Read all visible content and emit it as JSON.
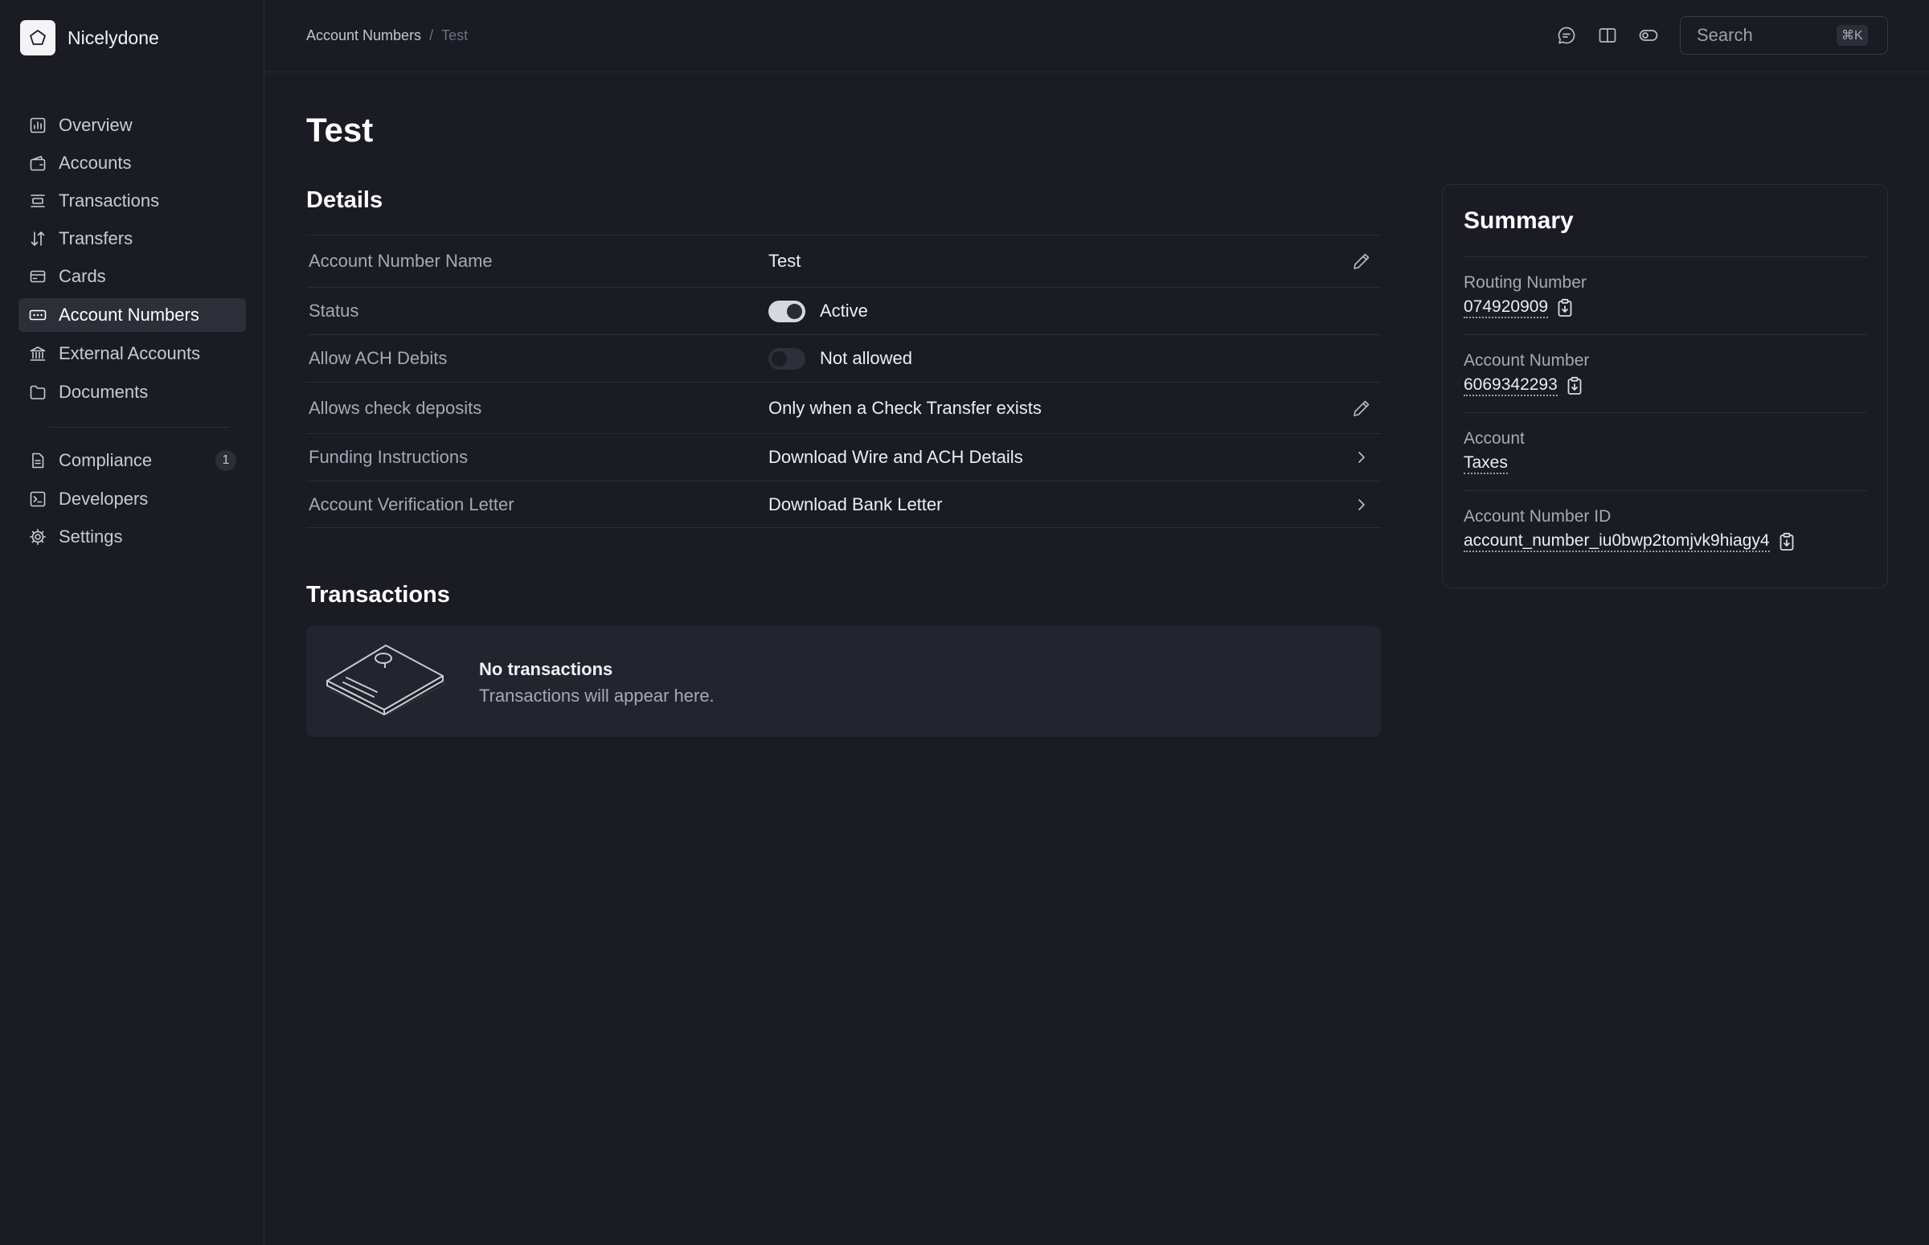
{
  "brand": {
    "name": "Nicelydone"
  },
  "sidebar": {
    "items": [
      {
        "label": "Overview",
        "icon": "chart-icon"
      },
      {
        "label": "Accounts",
        "icon": "wallet-icon"
      },
      {
        "label": "Transactions",
        "icon": "list-icon"
      },
      {
        "label": "Transfers",
        "icon": "arrows-updown-icon"
      },
      {
        "label": "Cards",
        "icon": "card-icon"
      },
      {
        "label": "Account Numbers",
        "icon": "keypad-icon",
        "active": true
      },
      {
        "label": "External Accounts",
        "icon": "bank-icon"
      },
      {
        "label": "Documents",
        "icon": "folder-icon"
      },
      {
        "label": "Compliance",
        "icon": "document-icon",
        "badge": "1"
      },
      {
        "label": "Developers",
        "icon": "terminal-icon"
      },
      {
        "label": "Settings",
        "icon": "gear-icon"
      }
    ]
  },
  "header": {
    "breadcrumb": {
      "parent": "Account Numbers",
      "separator": "/",
      "current": "Test"
    },
    "search": {
      "placeholder": "Search",
      "shortcut": "⌘K"
    }
  },
  "page": {
    "title": "Test"
  },
  "details": {
    "heading": "Details",
    "rows": [
      {
        "label": "Account Number Name",
        "value": "Test",
        "action": "pencil-icon"
      },
      {
        "label": "Status",
        "value": "Active",
        "toggle": true
      },
      {
        "label": "Allow ACH Debits",
        "value": "Not allowed",
        "toggle": false
      },
      {
        "label": "Allows check deposits",
        "value": "Only when a Check Transfer exists",
        "action": "pencil-icon"
      },
      {
        "label": "Funding Instructions",
        "value": "Download Wire and ACH Details",
        "action": "chevron-right-icon"
      },
      {
        "label": "Account Verification Letter",
        "value": "Download Bank Letter",
        "action": "chevron-right-icon"
      }
    ]
  },
  "transactions": {
    "heading": "Transactions",
    "empty_title": "No transactions",
    "empty_subtitle": "Transactions will appear here."
  },
  "summary": {
    "title": "Summary",
    "fields": [
      {
        "label": "Routing Number",
        "value": "074920909",
        "copy": true
      },
      {
        "label": "Account Number",
        "value": "6069342293",
        "copy": true
      },
      {
        "label": "Account",
        "value": "Taxes",
        "copy": false
      },
      {
        "label": "Account Number ID",
        "value": "account_number_iu0bwp2tomjvk9hiagy4",
        "copy": true
      }
    ]
  },
  "colors": {
    "background": "#1a1b23",
    "active_nav": "#2c2e38",
    "border": "#2b2d37"
  }
}
